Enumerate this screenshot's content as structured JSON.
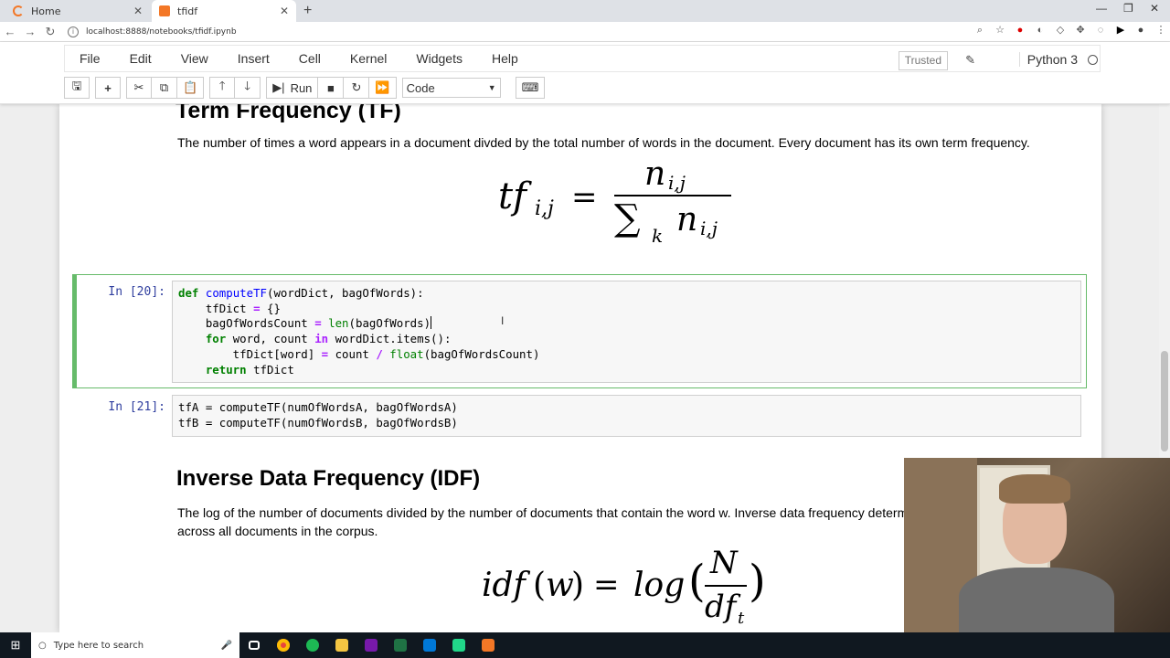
{
  "browser": {
    "tabs": [
      {
        "title": "Home",
        "active": false
      },
      {
        "title": "tfidf",
        "active": true
      }
    ],
    "url": "localhost:8888/notebooks/tfidf.ipynb",
    "window_controls": [
      "—",
      "❐",
      "✕"
    ]
  },
  "menu": {
    "items": [
      "File",
      "Edit",
      "View",
      "Insert",
      "Cell",
      "Kernel",
      "Widgets",
      "Help"
    ],
    "trusted_label": "Trusted",
    "kernel_name": "Python 3"
  },
  "toolbar": {
    "run_label": "Run",
    "cell_type": "Code"
  },
  "notebook": {
    "tf_heading": "Term Frequency (TF)",
    "tf_description": "The number of times a word appears in a document divded by the total number of words in the document. Every document has its own term frequency.",
    "cell20_prompt": "In [20]:",
    "cell21_prompt": "In [21]:",
    "cell21_line1": "tfA = computeTF(numOfWordsA, bagOfWordsA)",
    "cell21_line2": "tfB = computeTF(numOfWordsB, bagOfWordsB)",
    "idf_heading": "Inverse Data Frequency (IDF)",
    "idf_description_line1": "The log of the number of documents divided by the number of documents that contain the word w. Inverse data frequency determ",
    "idf_description_line2": "across all documents in the corpus."
  },
  "taskbar": {
    "search_placeholder": "Type here to search"
  },
  "colors": {
    "selected_cell_border": "#66bb6a",
    "prompt": "#303f9f",
    "keyword": "#008000",
    "function_name": "#0000ff"
  }
}
